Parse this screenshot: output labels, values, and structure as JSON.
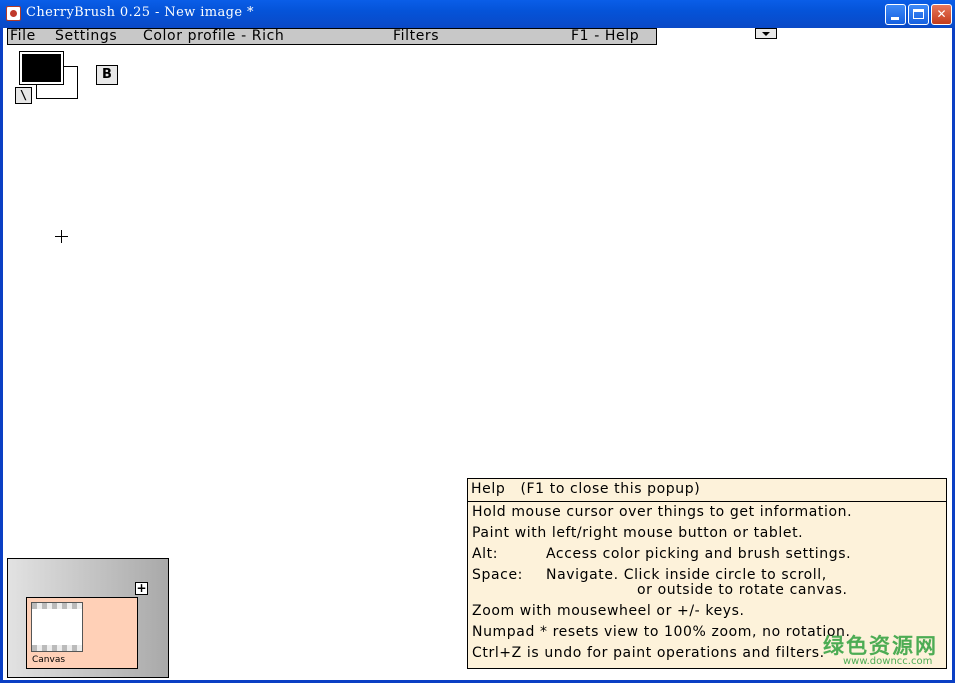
{
  "window": {
    "title": "CherryBrush 0.25 - New image *",
    "frame_color": "#0a3fc4"
  },
  "menu": {
    "file": "File",
    "settings": "Settings",
    "color_profile": "Color profile - Rich",
    "filters": "Filters",
    "help": "F1 - Help"
  },
  "toolbar": {
    "foreground_color": "#000000",
    "background_color": "#ffffff",
    "swap_label": "\\",
    "brush_label": "B"
  },
  "navigator": {
    "label": "Canvas",
    "plus_label": "+",
    "card_color": "#ffd0b7"
  },
  "help": {
    "title": "Help   (F1 to close this popup)",
    "lines": [
      "Hold mouse cursor over things to get information.",
      "Paint with left/right mouse button or tablet."
    ],
    "alt_key": "Alt:",
    "alt_desc": "Access color picking and brush settings.",
    "space_key": "Space:",
    "space_desc_1": "Navigate. Click inside circle to scroll,",
    "space_desc_2": "or outside to rotate canvas.",
    "zoom": "Zoom with mousewheel or +/- keys.",
    "numpad": "Numpad * resets view to 100% zoom, no rotation.",
    "undo": "Ctrl+Z is undo for paint operations and filters."
  },
  "watermark": {
    "text": "绿色资源网",
    "url": "www.downcc.com"
  }
}
